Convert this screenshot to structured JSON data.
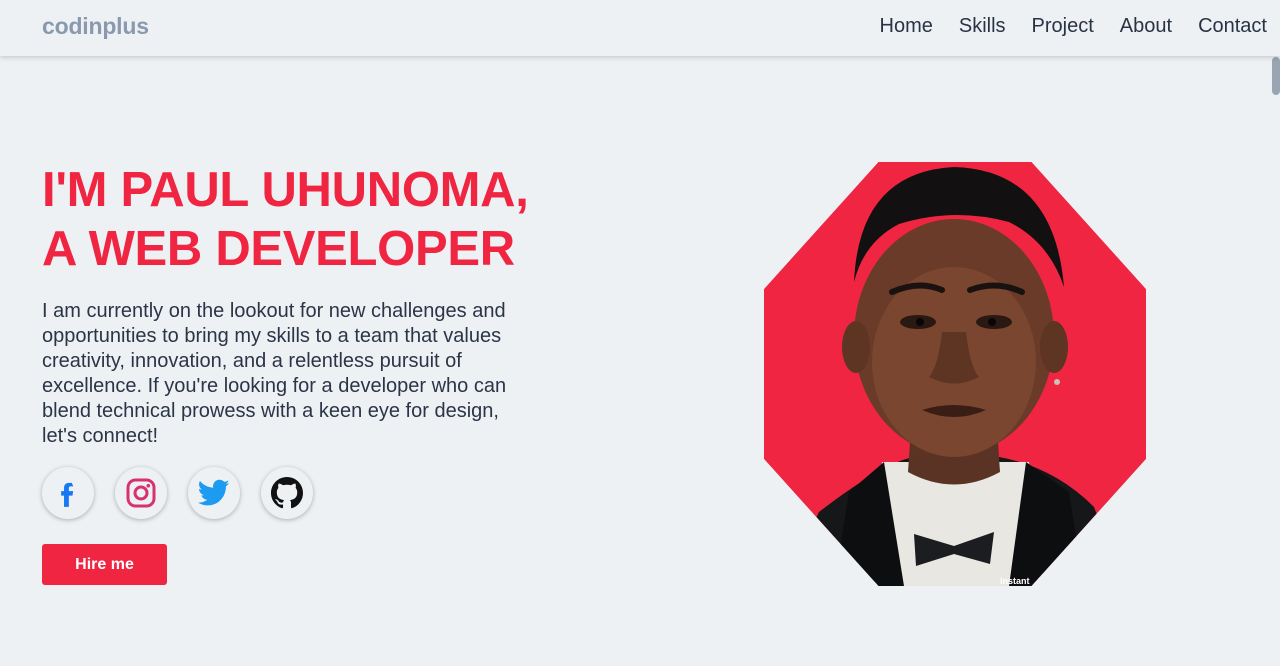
{
  "header": {
    "logo": "codinplus",
    "nav": [
      "Home",
      "Skills",
      "Project",
      "About",
      "Contact"
    ]
  },
  "hero": {
    "title_line1": "I'M PAUL UHUNOMA,",
    "title_line2": "A WEB DEVELOPER",
    "description": "I am currently on the lookout for new challenges and opportunities to bring my skills to a team that values creativity, innovation, and a relentless pursuit of excellence. If you're looking for a developer who can blend technical prowess with a keen eye for design, let's connect!",
    "socials": [
      {
        "name": "facebook",
        "icon": "facebook-icon",
        "color": "#1877f2"
      },
      {
        "name": "instagram",
        "icon": "instagram-icon",
        "color": "#d6336c"
      },
      {
        "name": "twitter",
        "icon": "twitter-icon",
        "color": "#1d9bf0"
      },
      {
        "name": "github",
        "icon": "github-icon",
        "color": "#111111"
      }
    ],
    "hire_label": "Hire me",
    "portrait_watermark": "instant"
  },
  "colors": {
    "accent": "#ef2541",
    "background": "#edf1f4",
    "logo": "#8a99ae",
    "text": "#2c3447"
  }
}
